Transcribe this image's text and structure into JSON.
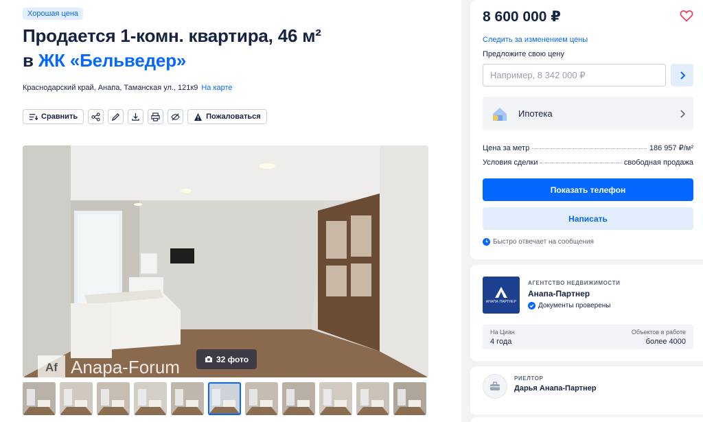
{
  "listing": {
    "badge": "Хорошая цена",
    "title_line1": "Продается 1-комн. квартира, 46 м²",
    "title_prefix": "в",
    "complex_link": "ЖК «Бельведер»",
    "address": "Краснодарский край, Анапа, Таманская ул., 121к9",
    "map_link": "На карте"
  },
  "toolbar": {
    "compare_label": "Сравнить",
    "report_label": "Пожаловаться",
    "icons": [
      "compare-icon",
      "share-icon",
      "edit-icon",
      "download-icon",
      "print-icon",
      "hide-icon",
      "warning-icon"
    ]
  },
  "gallery": {
    "photo_count_label": "32 фото",
    "watermark_logo": "Af",
    "watermark_text": "Anapa-Forum",
    "thumbnail_count": 11,
    "active_thumbnail": 5
  },
  "sidebar": {
    "price": "8 600 000 ₽",
    "follow_price": "Следить за изменением цены",
    "offer_label": "Предложите свою цену",
    "offer_placeholder": "Например, 8 342 000 ₽",
    "mortgage_label": "Ипотека",
    "price_per_meter_label": "Цена за метр",
    "price_per_meter_value": "186 957 ₽/м²",
    "deal_terms_label": "Условия сделки",
    "deal_terms_value": "свободная продажа",
    "show_phone": "Показать телефон",
    "write": "Написать",
    "fast_reply": "Быстро отвечает на сообщения"
  },
  "agency": {
    "type": "АГЕНТСТВО НЕДВИЖИМОСТИ",
    "name": "Анапа-Партнер",
    "logo_text": "АНАПА ПАРТНЕР",
    "docs_verified": "Документы проверены",
    "on_cian_label": "На Циан",
    "on_cian_value": "4 года",
    "objects_label": "Объектов в работе",
    "objects_value": "более 4000"
  },
  "realtor": {
    "type": "РИЕЛТОР",
    "name": "Дарья Анапа-Партнер"
  },
  "colors": {
    "accent": "#0468ff",
    "accent_light": "#e2eefe",
    "text": "#152242",
    "favorite": "#e84260"
  }
}
